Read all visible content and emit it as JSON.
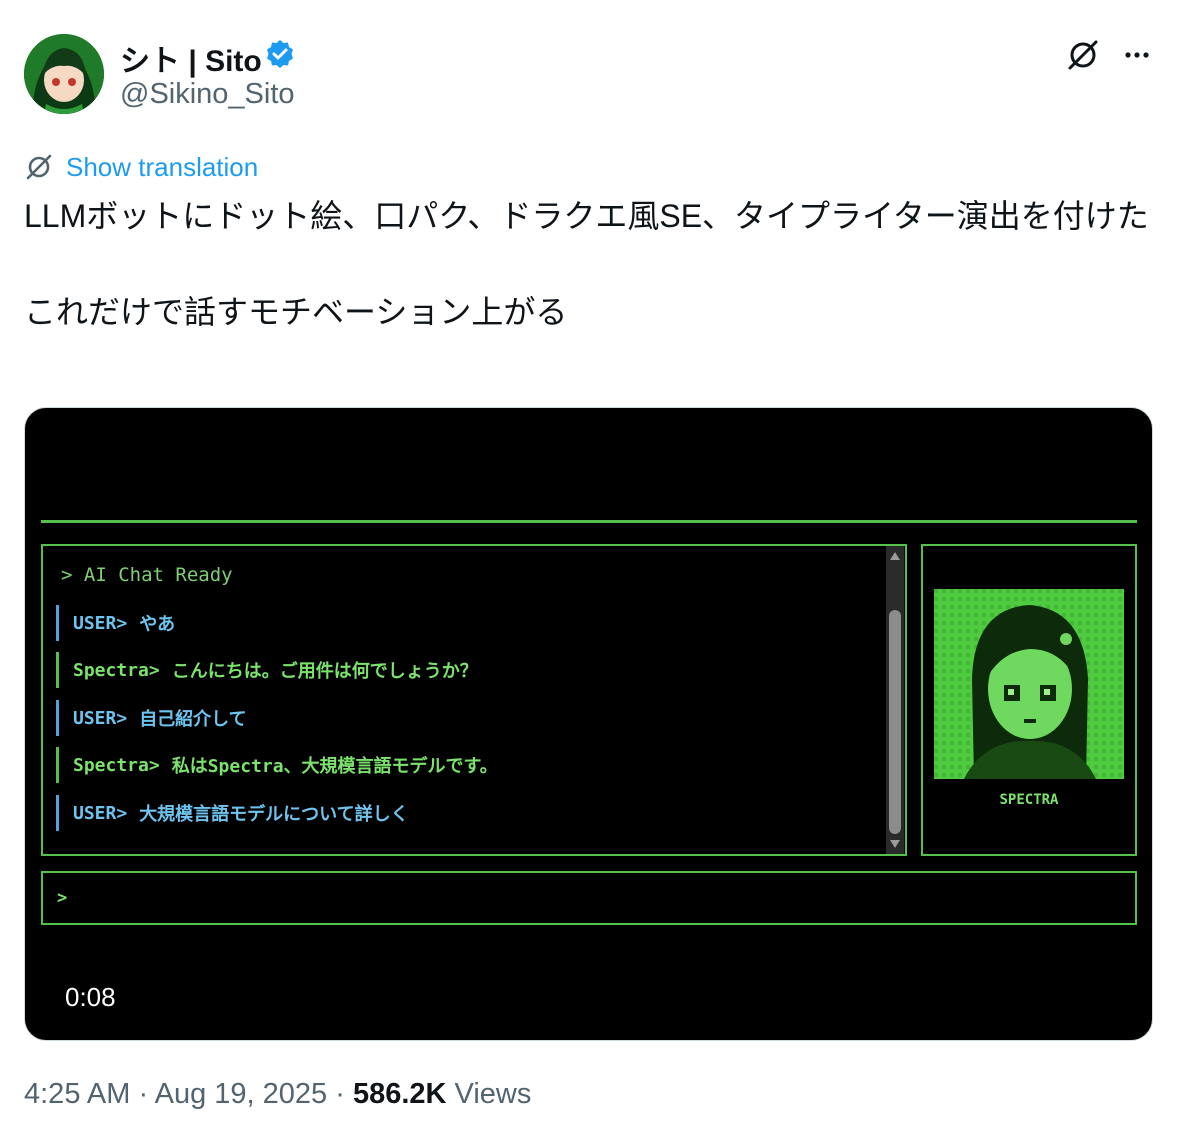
{
  "author": {
    "display_name": "シト | Sito",
    "handle": "@Sikino_Sito",
    "verified_badge_color": "#1d9bf0",
    "avatar_icon": "anime-avatar"
  },
  "header_actions": {
    "grok_icon": "grok-icon",
    "more_icon": "more-icon"
  },
  "translation": {
    "icon": "grok-icon",
    "label": "Show translation"
  },
  "tweet": {
    "text": "LLMボットにドット絵、口パク、ドラクエ風SE、タイプライター演出を付けた\n\nこれだけで話すモチベーション上がる"
  },
  "video": {
    "timestamp": "0:08",
    "accent_color": "#56c04d",
    "user_color": "#6fc3ef",
    "system_line": "> AI Chat Ready",
    "messages": [
      {
        "speaker": "USER>",
        "text": "やあ",
        "role": "user"
      },
      {
        "speaker": "Spectra>",
        "text": "こんにちは。ご用件は何でしょうか？",
        "role": "bot"
      },
      {
        "speaker": "USER>",
        "text": "自己紹介して",
        "role": "user"
      },
      {
        "speaker": "Spectra>",
        "text": "私はSpectra、大規模言語モデルです。",
        "role": "bot"
      },
      {
        "speaker": "USER>",
        "text": "大規模言語モデルについて詳しく",
        "role": "user"
      }
    ],
    "portrait_label": "SPECTRA",
    "input_prompt": ">"
  },
  "meta": {
    "time": "4:25 AM",
    "separator": "·",
    "date": "Aug 19, 2025",
    "views_count": "586.2K",
    "views_label": "Views"
  }
}
